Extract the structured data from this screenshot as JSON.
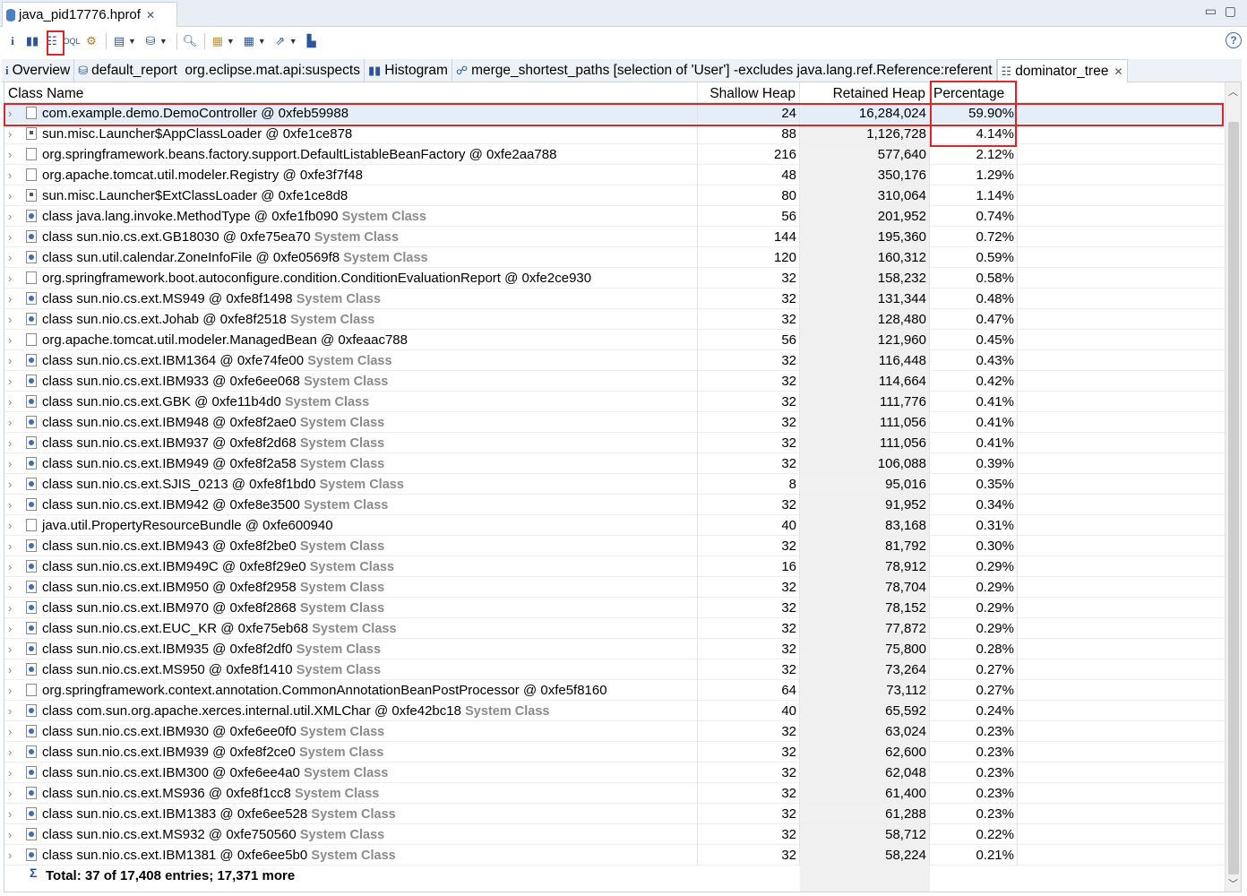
{
  "editor_tab": {
    "title": "java_pid17776.hprof"
  },
  "toolbar": {
    "items": [
      "info-icon",
      "histogram-icon",
      "dominator-tree-icon",
      "oql-icon",
      "thread-overview-icon",
      "run-report-icon",
      "query-browser-icon",
      "search-icon",
      "group-icon",
      "calculate-icon",
      "export-icon",
      "pin-icon"
    ]
  },
  "tabs": [
    {
      "label": "Overview"
    },
    {
      "label": "default_report  org.eclipse.mat.api:suspects"
    },
    {
      "label": "Histogram"
    },
    {
      "label": "merge_shortest_paths [selection of 'User'] -excludes java.lang.ref.Reference:referent"
    },
    {
      "label": "dominator_tree"
    }
  ],
  "columns": [
    "Class Name",
    "Shallow Heap",
    "Retained Heap",
    "Percentage"
  ],
  "system_class_label": "System Class",
  "rows": [
    {
      "name": "com.example.demo.DemoController @ 0xfeb59988",
      "sys": "",
      "shallow": "24",
      "retained": "16,284,024",
      "pct": "59.90%",
      "icon": "obj"
    },
    {
      "name": "sun.misc.Launcher$AppClassLoader @ 0xfe1ce878",
      "sys": "",
      "shallow": "88",
      "retained": "1,126,728",
      "pct": "4.14%",
      "icon": "loader"
    },
    {
      "name": "org.springframework.beans.factory.support.DefaultListableBeanFactory @ 0xfe2aa788",
      "sys": "",
      "shallow": "216",
      "retained": "577,640",
      "pct": "2.12%",
      "icon": "obj"
    },
    {
      "name": "org.apache.tomcat.util.modeler.Registry @ 0xfe3f7f48",
      "sys": "",
      "shallow": "48",
      "retained": "350,176",
      "pct": "1.29%",
      "icon": "obj"
    },
    {
      "name": "sun.misc.Launcher$ExtClassLoader @ 0xfe1ce8d8",
      "sys": "",
      "shallow": "80",
      "retained": "310,064",
      "pct": "1.14%",
      "icon": "loader"
    },
    {
      "name": "class java.lang.invoke.MethodType @ 0xfe1fb090",
      "sys": "System Class",
      "shallow": "56",
      "retained": "201,952",
      "pct": "0.74%",
      "icon": "cls"
    },
    {
      "name": "class sun.nio.cs.ext.GB18030 @ 0xfe75ea70",
      "sys": "System Class",
      "shallow": "144",
      "retained": "195,360",
      "pct": "0.72%",
      "icon": "cls"
    },
    {
      "name": "class sun.util.calendar.ZoneInfoFile @ 0xfe0569f8",
      "sys": "System Class",
      "shallow": "120",
      "retained": "160,312",
      "pct": "0.59%",
      "icon": "cls"
    },
    {
      "name": "org.springframework.boot.autoconfigure.condition.ConditionEvaluationReport @ 0xfe2ce930",
      "sys": "",
      "shallow": "32",
      "retained": "158,232",
      "pct": "0.58%",
      "icon": "obj"
    },
    {
      "name": "class sun.nio.cs.ext.MS949 @ 0xfe8f1498",
      "sys": "System Class",
      "shallow": "32",
      "retained": "131,344",
      "pct": "0.48%",
      "icon": "cls"
    },
    {
      "name": "class sun.nio.cs.ext.Johab @ 0xfe8f2518",
      "sys": "System Class",
      "shallow": "32",
      "retained": "128,480",
      "pct": "0.47%",
      "icon": "cls"
    },
    {
      "name": "org.apache.tomcat.util.modeler.ManagedBean @ 0xfeaac788",
      "sys": "",
      "shallow": "56",
      "retained": "121,960",
      "pct": "0.45%",
      "icon": "obj"
    },
    {
      "name": "class sun.nio.cs.ext.IBM1364 @ 0xfe74fe00",
      "sys": "System Class",
      "shallow": "32",
      "retained": "116,448",
      "pct": "0.43%",
      "icon": "cls"
    },
    {
      "name": "class sun.nio.cs.ext.IBM933 @ 0xfe6ee068",
      "sys": "System Class",
      "shallow": "32",
      "retained": "114,664",
      "pct": "0.42%",
      "icon": "cls"
    },
    {
      "name": "class sun.nio.cs.ext.GBK @ 0xfe11b4d0",
      "sys": "System Class",
      "shallow": "32",
      "retained": "111,776",
      "pct": "0.41%",
      "icon": "cls"
    },
    {
      "name": "class sun.nio.cs.ext.IBM948 @ 0xfe8f2ae0",
      "sys": "System Class",
      "shallow": "32",
      "retained": "111,056",
      "pct": "0.41%",
      "icon": "cls"
    },
    {
      "name": "class sun.nio.cs.ext.IBM937 @ 0xfe8f2d68",
      "sys": "System Class",
      "shallow": "32",
      "retained": "111,056",
      "pct": "0.41%",
      "icon": "cls"
    },
    {
      "name": "class sun.nio.cs.ext.IBM949 @ 0xfe8f2a58",
      "sys": "System Class",
      "shallow": "32",
      "retained": "106,088",
      "pct": "0.39%",
      "icon": "cls"
    },
    {
      "name": "class sun.nio.cs.ext.SJIS_0213 @ 0xfe8f1bd0",
      "sys": "System Class",
      "shallow": "8",
      "retained": "95,016",
      "pct": "0.35%",
      "icon": "cls"
    },
    {
      "name": "class sun.nio.cs.ext.IBM942 @ 0xfe8e3500",
      "sys": "System Class",
      "shallow": "32",
      "retained": "91,952",
      "pct": "0.34%",
      "icon": "cls"
    },
    {
      "name": "java.util.PropertyResourceBundle @ 0xfe600940",
      "sys": "",
      "shallow": "40",
      "retained": "83,168",
      "pct": "0.31%",
      "icon": "obj"
    },
    {
      "name": "class sun.nio.cs.ext.IBM943 @ 0xfe8f2be0",
      "sys": "System Class",
      "shallow": "32",
      "retained": "81,792",
      "pct": "0.30%",
      "icon": "cls"
    },
    {
      "name": "class sun.nio.cs.ext.IBM949C @ 0xfe8f29e0",
      "sys": "System Class",
      "shallow": "16",
      "retained": "78,912",
      "pct": "0.29%",
      "icon": "cls"
    },
    {
      "name": "class sun.nio.cs.ext.IBM950 @ 0xfe8f2958",
      "sys": "System Class",
      "shallow": "32",
      "retained": "78,704",
      "pct": "0.29%",
      "icon": "cls"
    },
    {
      "name": "class sun.nio.cs.ext.IBM970 @ 0xfe8f2868",
      "sys": "System Class",
      "shallow": "32",
      "retained": "78,152",
      "pct": "0.29%",
      "icon": "cls"
    },
    {
      "name": "class sun.nio.cs.ext.EUC_KR @ 0xfe75eb68",
      "sys": "System Class",
      "shallow": "32",
      "retained": "77,872",
      "pct": "0.29%",
      "icon": "cls"
    },
    {
      "name": "class sun.nio.cs.ext.IBM935 @ 0xfe8f2df0",
      "sys": "System Class",
      "shallow": "32",
      "retained": "75,800",
      "pct": "0.28%",
      "icon": "cls"
    },
    {
      "name": "class sun.nio.cs.ext.MS950 @ 0xfe8f1410",
      "sys": "System Class",
      "shallow": "32",
      "retained": "73,264",
      "pct": "0.27%",
      "icon": "cls"
    },
    {
      "name": "org.springframework.context.annotation.CommonAnnotationBeanPostProcessor @ 0xfe5f8160",
      "sys": "",
      "shallow": "64",
      "retained": "73,112",
      "pct": "0.27%",
      "icon": "obj"
    },
    {
      "name": "class com.sun.org.apache.xerces.internal.util.XMLChar @ 0xfe42bc18",
      "sys": "System Class",
      "shallow": "40",
      "retained": "65,592",
      "pct": "0.24%",
      "icon": "cls"
    },
    {
      "name": "class sun.nio.cs.ext.IBM930 @ 0xfe6ee0f0",
      "sys": "System Class",
      "shallow": "32",
      "retained": "63,024",
      "pct": "0.23%",
      "icon": "cls"
    },
    {
      "name": "class sun.nio.cs.ext.IBM939 @ 0xfe8f2ce0",
      "sys": "System Class",
      "shallow": "32",
      "retained": "62,600",
      "pct": "0.23%",
      "icon": "cls"
    },
    {
      "name": "class sun.nio.cs.ext.IBM300 @ 0xfe6ee4a0",
      "sys": "System Class",
      "shallow": "32",
      "retained": "62,048",
      "pct": "0.23%",
      "icon": "cls"
    },
    {
      "name": "class sun.nio.cs.ext.MS936 @ 0xfe8f1cc8",
      "sys": "System Class",
      "shallow": "32",
      "retained": "61,400",
      "pct": "0.23%",
      "icon": "cls"
    },
    {
      "name": "class sun.nio.cs.ext.IBM1383 @ 0xfe6ee528",
      "sys": "System Class",
      "shallow": "32",
      "retained": "61,288",
      "pct": "0.23%",
      "icon": "cls"
    },
    {
      "name": "class sun.nio.cs.ext.MS932 @ 0xfe750560",
      "sys": "System Class",
      "shallow": "32",
      "retained": "58,712",
      "pct": "0.22%",
      "icon": "cls"
    },
    {
      "name": "class sun.nio.cs.ext.IBM1381 @ 0xfe6ee5b0",
      "sys": "System Class",
      "shallow": "32",
      "retained": "58,224",
      "pct": "0.21%",
      "icon": "cls"
    }
  ],
  "total": "Total: 37 of 17,408 entries; 17,371 more",
  "colors": {
    "highlight": "#d9262c",
    "selected_row": "#e4eef9",
    "system_class_text": "#8b8b8b"
  }
}
